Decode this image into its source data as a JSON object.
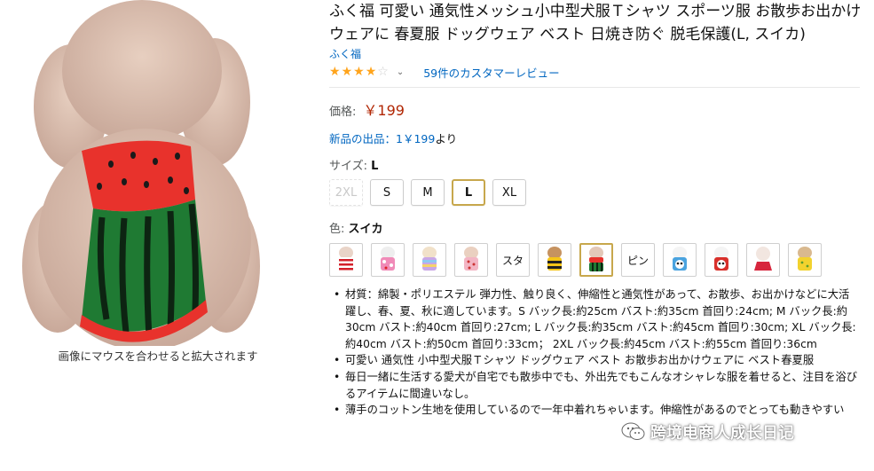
{
  "image": {
    "zoom_hint": "画像にマウスを合わせると拡大されます",
    "icon": "dog-in-watermelon-vest"
  },
  "product": {
    "title": "ふく福 可愛い 通気性メッシュ小中型犬服Ｔシャツ スポーツ服 お散歩お出かけウェアに 春夏服 ドッグウェア ベスト 日焼き防ぐ 脱毛保護(L, スイカ)",
    "brand": "ふく福",
    "rating": 4.5,
    "review_link": "59件のカスタマーレビュー",
    "price_label": "価格:",
    "price": "￥199",
    "new_offers_link": "新品の出品：1￥199",
    "new_offers_suffix": "より"
  },
  "size": {
    "label": "サイズ:",
    "selected": "L",
    "options": [
      {
        "label": "2XL",
        "state": "disabled"
      },
      {
        "label": "S",
        "state": "available"
      },
      {
        "label": "M",
        "state": "available"
      },
      {
        "label": "L",
        "state": "selected"
      },
      {
        "label": "XL",
        "state": "available"
      }
    ]
  },
  "color": {
    "label": "色:",
    "selected": "スイカ",
    "swatches": [
      {
        "kind": "image",
        "icon": "red-striped-shirt-dog",
        "selected": false
      },
      {
        "kind": "image",
        "icon": "pink-floral-dog",
        "selected": false
      },
      {
        "kind": "image",
        "icon": "rainbow-dog",
        "selected": false
      },
      {
        "kind": "image",
        "icon": "pink-dot-dog",
        "selected": false
      },
      {
        "kind": "text",
        "text": "スタ",
        "selected": false
      },
      {
        "kind": "image",
        "icon": "bee-costume-dog",
        "selected": false
      },
      {
        "kind": "image",
        "icon": "watermelon-dog",
        "selected": true
      },
      {
        "kind": "text",
        "text": "ピン",
        "selected": false
      },
      {
        "kind": "image",
        "icon": "blue-panda-dog",
        "selected": false
      },
      {
        "kind": "image",
        "icon": "red-panda-dog",
        "selected": false
      },
      {
        "kind": "image",
        "icon": "red-skirt-dog",
        "selected": false
      },
      {
        "kind": "image",
        "icon": "yellow-lemon-dog",
        "selected": false
      }
    ]
  },
  "bullets": [
    "材質：綿製・ポリエステル 弾力性、触り良く、伸縮性と通気性があって、お散歩、お出かけなどに大活躍し、春、夏、秋に適しています。S バック長:約25cm バスト:約35cm 首回り:24cm; M バック長:約30cm バスト:約40cm 首回り:27cm; L バック長:約35cm バスト:約45cm 首回り:30cm; XL バック長:約40cm バスト:約50cm 首回り:33cm； 2XL バック長:約45cm バスト:約55cm 首回り:36cm",
    "可愛い 通気性 小中型犬服Ｔシャツ ドッグウェア ベスト お散歩お出かけウェアに ベスト春夏服",
    "毎日一緒に生活する愛犬が自宅でも散歩中でも、外出先でもこんなオシャレな服を着せると、注目を浴びるアイテムに間違いなし。",
    "薄手のコットン生地を使用しているので一年中着れちゃいます。伸縮性があるのでとっても動きやすい"
  ],
  "watermark": {
    "text": "跨境电商人成长日记",
    "icon": "wechat-icon"
  },
  "colors": {
    "link": "#0066c0",
    "price": "#b12704",
    "star": "#ffa41c",
    "selected_border": "#c7a74c"
  }
}
